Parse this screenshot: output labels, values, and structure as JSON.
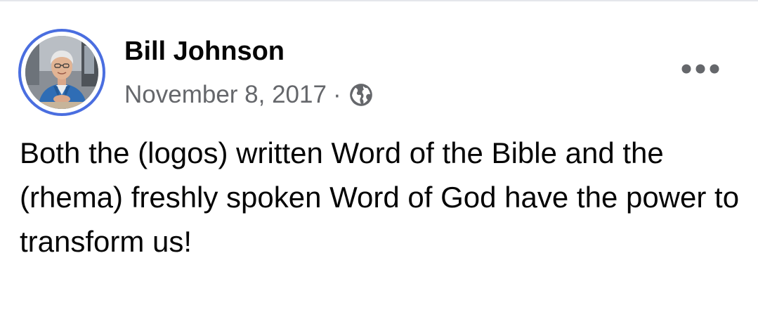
{
  "post": {
    "author": {
      "name": "Bill Johnson",
      "avatar_icon": "profile-photo-avatar",
      "ring_color": "#4a6ee0"
    },
    "timestamp": "November 8, 2017",
    "separator": "·",
    "audience_icon": "globe-icon",
    "more_icon": "more-options-icon",
    "text": "Both the (logos) written Word of the Bible and the (rhema) freshly spoken Word of God have the power to transform us!"
  },
  "colors": {
    "text_primary": "#050505",
    "text_secondary": "#65676b",
    "avatar_ring": "#4a6ee0"
  }
}
